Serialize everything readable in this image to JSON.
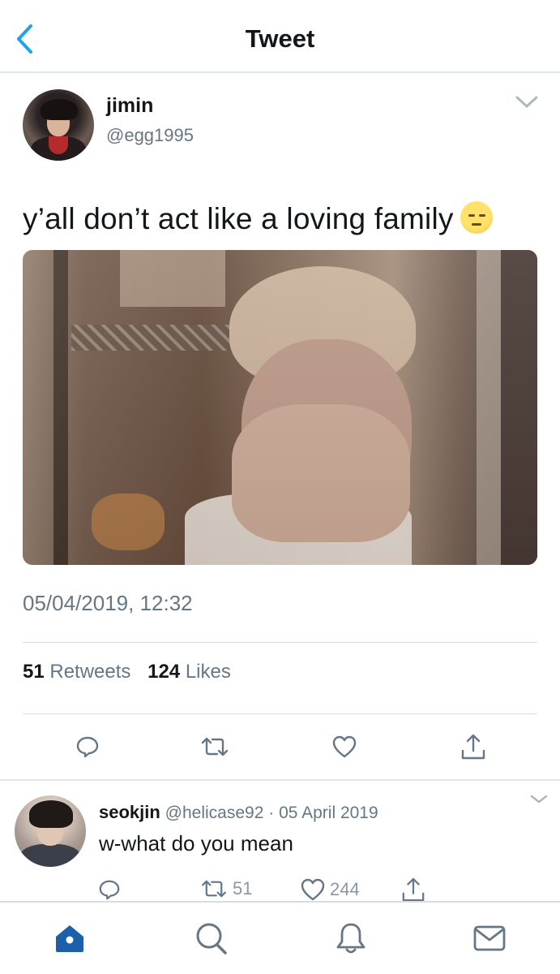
{
  "header": {
    "title": "Tweet"
  },
  "tweet": {
    "author": {
      "name": "jimin",
      "handle": "@egg1995"
    },
    "text": "y’all don’t act like a loving family",
    "timestamp": "05/04/2019, 12:32",
    "retweets": {
      "count": "51",
      "label": "Retweets"
    },
    "likes": {
      "count": "124",
      "label": "Likes"
    }
  },
  "reply": {
    "name": "seokjin",
    "handle": "@helicase92",
    "separator": " · ",
    "date": "05 April 2019",
    "text": "w-what do you mean",
    "retweet_count": "51",
    "like_count": "244"
  },
  "icons": {
    "back": "chevron-left-icon",
    "more": "chevron-down-icon",
    "reply": "comment-icon",
    "retweet": "retweet-icon",
    "like": "heart-icon",
    "share": "share-icon",
    "home": "home-icon",
    "search": "search-icon",
    "notifications": "bell-icon",
    "messages": "mail-icon"
  },
  "colors": {
    "accent": "#1da1f2",
    "active_tab": "#1c5fab",
    "icon_gray": "#657786",
    "text_secondary": "#657786"
  }
}
